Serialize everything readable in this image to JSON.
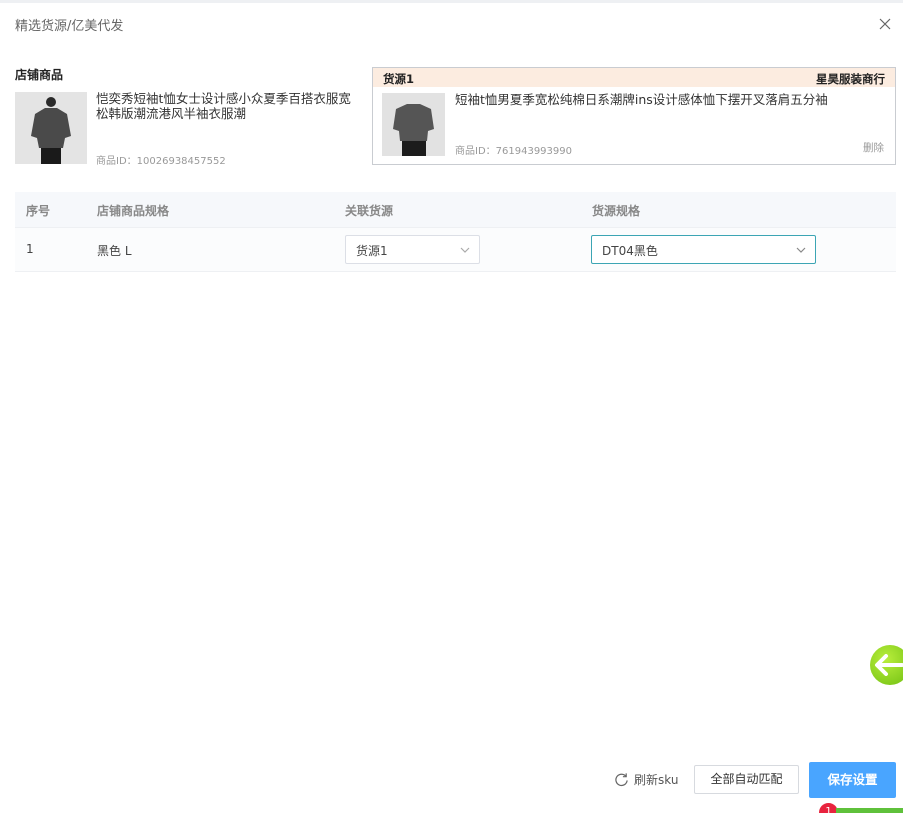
{
  "dialog": {
    "title": "精选货源/亿美代发"
  },
  "store": {
    "section_title": "店铺商品",
    "product_title": "恺奕秀短袖t恤女士设计感小众夏季百搭衣服宽松韩版潮流港风半袖衣服潮",
    "product_id": "商品ID：10026938457552"
  },
  "supplier": {
    "label": "货源1",
    "shop_name": "星昊服装商行",
    "product_title": "短袖t恤男夏季宽松纯棉日系潮牌ins设计感体恤下摆开叉落肩五分袖",
    "product_id": "商品ID：761943993990",
    "delete_label": "删除"
  },
  "table": {
    "headers": [
      "序号",
      "店铺商品规格",
      "关联货源",
      "货源规格"
    ],
    "rows": [
      {
        "index": "1",
        "spec": "黑色 L",
        "source": "货源1",
        "source_spec": "DT04黑色"
      }
    ]
  },
  "footer": {
    "refresh_label": "刷新sku",
    "auto_match_label": "全部自动匹配",
    "save_label": "保存设置"
  },
  "notification": {
    "count": "1"
  },
  "colors": {
    "accent": "#49a5ff",
    "supplier_header": "#fcece0",
    "focus_border": "#3ca5b4"
  }
}
